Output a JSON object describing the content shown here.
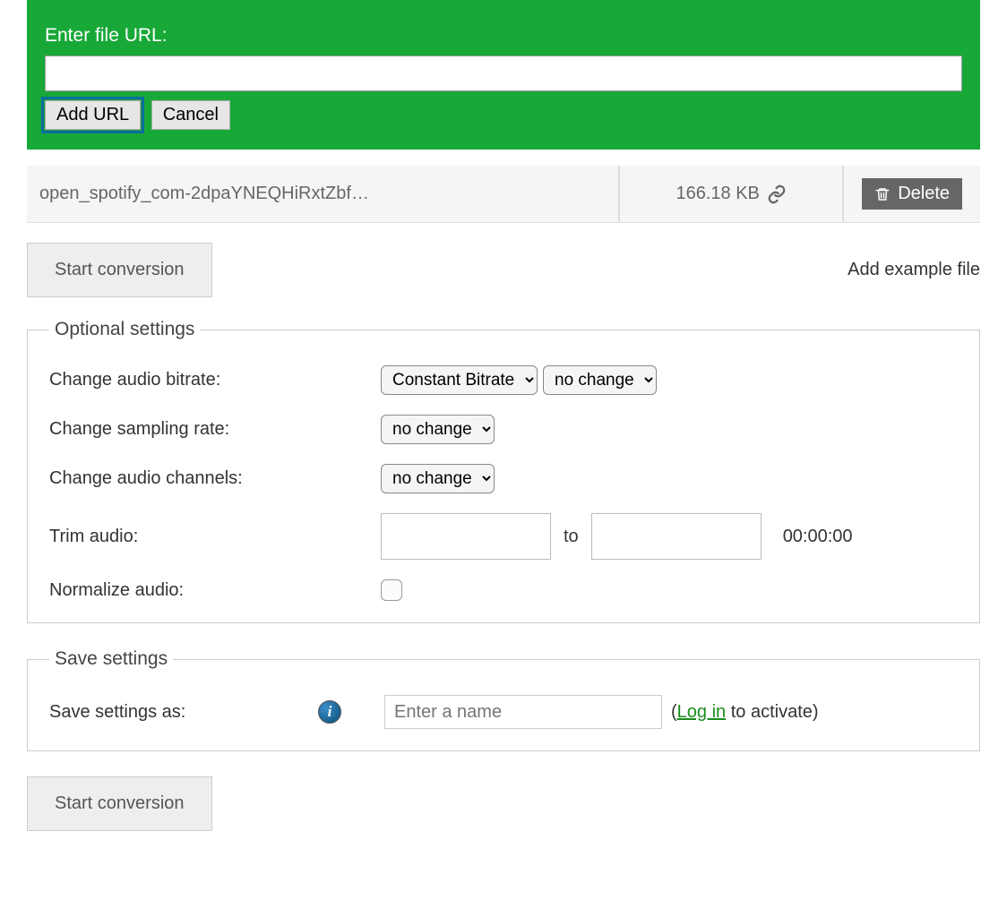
{
  "url_panel": {
    "label": "Enter file URL:",
    "add_btn": "Add URL",
    "cancel_btn": "Cancel"
  },
  "file": {
    "name": "open_spotify_com-2dpaYNEQHiRxtZbf…",
    "size": "166.18 KB",
    "delete_btn": "Delete"
  },
  "actions": {
    "start": "Start conversion",
    "example": "Add example file"
  },
  "optional": {
    "legend": "Optional settings",
    "bitrate_label": "Change audio bitrate:",
    "bitrate_mode": "Constant Bitrate",
    "bitrate_value": "no change",
    "sampling_label": "Change sampling rate:",
    "sampling_value": "no change",
    "channels_label": "Change audio channels:",
    "channels_value": "no change",
    "trim_label": "Trim audio:",
    "trim_to": "to",
    "trim_duration": "00:00:00",
    "normalize_label": "Normalize audio:"
  },
  "save": {
    "legend": "Save settings",
    "label": "Save settings as:",
    "placeholder": "Enter a name",
    "login": "Log in",
    "activate": " to activate)"
  }
}
